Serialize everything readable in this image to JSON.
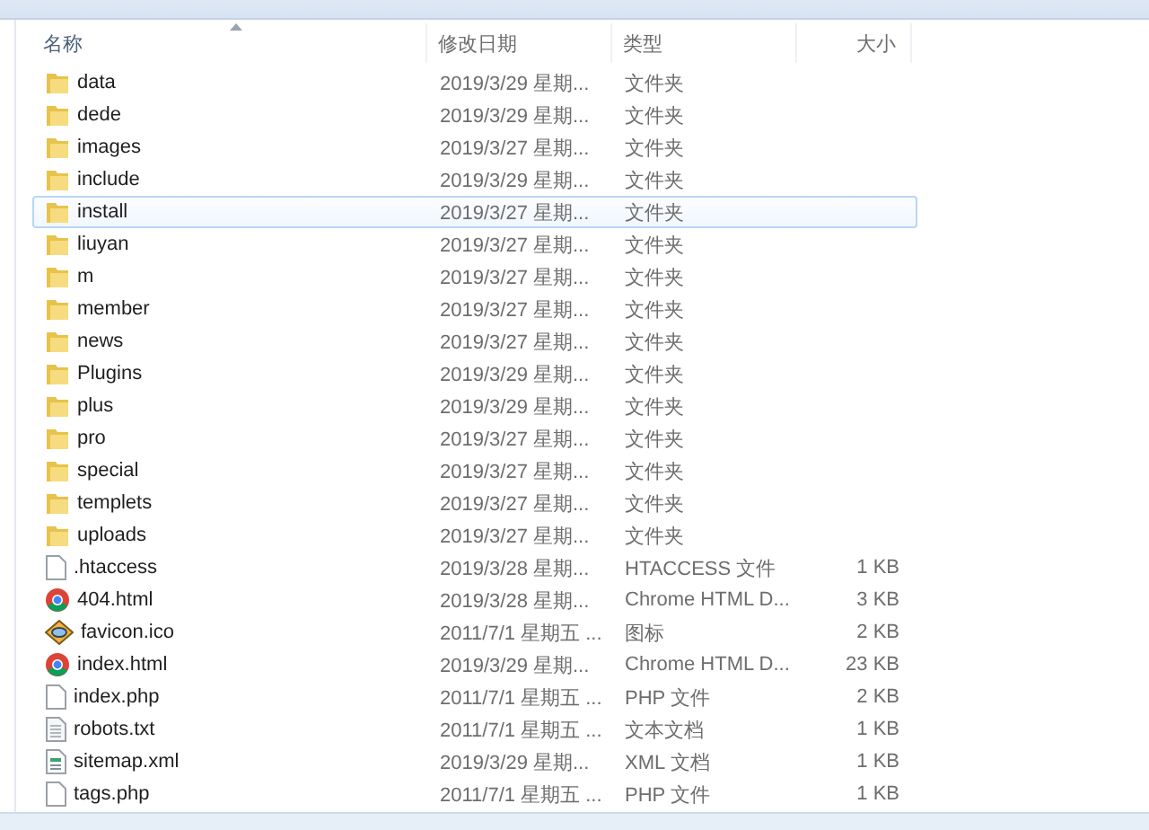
{
  "table": {
    "columns": [
      {
        "label": "名称",
        "sorted": true
      },
      {
        "label": "修改日期",
        "sorted": false
      },
      {
        "label": "类型",
        "sorted": false
      },
      {
        "label": "大小",
        "sorted": false
      }
    ],
    "rows": [
      {
        "kind": "folder",
        "name": "data",
        "date": "2019/3/29 星期...",
        "type": "文件夹",
        "size": "",
        "selected": false
      },
      {
        "kind": "folder",
        "name": "dede",
        "date": "2019/3/29 星期...",
        "type": "文件夹",
        "size": "",
        "selected": false
      },
      {
        "kind": "folder",
        "name": "images",
        "date": "2019/3/27 星期...",
        "type": "文件夹",
        "size": "",
        "selected": false
      },
      {
        "kind": "folder",
        "name": "include",
        "date": "2019/3/29 星期...",
        "type": "文件夹",
        "size": "",
        "selected": false
      },
      {
        "kind": "folder",
        "name": "install",
        "date": "2019/3/27 星期...",
        "type": "文件夹",
        "size": "",
        "selected": true
      },
      {
        "kind": "folder",
        "name": "liuyan",
        "date": "2019/3/27 星期...",
        "type": "文件夹",
        "size": "",
        "selected": false
      },
      {
        "kind": "folder",
        "name": "m",
        "date": "2019/3/27 星期...",
        "type": "文件夹",
        "size": "",
        "selected": false
      },
      {
        "kind": "folder",
        "name": "member",
        "date": "2019/3/27 星期...",
        "type": "文件夹",
        "size": "",
        "selected": false
      },
      {
        "kind": "folder",
        "name": "news",
        "date": "2019/3/27 星期...",
        "type": "文件夹",
        "size": "",
        "selected": false
      },
      {
        "kind": "folder",
        "name": "Plugins",
        "date": "2019/3/29 星期...",
        "type": "文件夹",
        "size": "",
        "selected": false
      },
      {
        "kind": "folder",
        "name": "plus",
        "date": "2019/3/29 星期...",
        "type": "文件夹",
        "size": "",
        "selected": false
      },
      {
        "kind": "folder",
        "name": "pro",
        "date": "2019/3/27 星期...",
        "type": "文件夹",
        "size": "",
        "selected": false
      },
      {
        "kind": "folder",
        "name": "special",
        "date": "2019/3/27 星期...",
        "type": "文件夹",
        "size": "",
        "selected": false
      },
      {
        "kind": "folder",
        "name": "templets",
        "date": "2019/3/27 星期...",
        "type": "文件夹",
        "size": "",
        "selected": false
      },
      {
        "kind": "folder",
        "name": "uploads",
        "date": "2019/3/27 星期...",
        "type": "文件夹",
        "size": "",
        "selected": false
      },
      {
        "kind": "blank",
        "name": ".htaccess",
        "date": "2019/3/28 星期...",
        "type": "HTACCESS 文件",
        "size": "1 KB",
        "selected": false
      },
      {
        "kind": "chrome",
        "name": "404.html",
        "date": "2019/3/28 星期...",
        "type": "Chrome HTML D...",
        "size": "3 KB",
        "selected": false
      },
      {
        "kind": "ico",
        "name": "favicon.ico",
        "date": "2011/7/1 星期五 ...",
        "type": "图标",
        "size": "2 KB",
        "selected": false
      },
      {
        "kind": "chrome",
        "name": "index.html",
        "date": "2019/3/29 星期...",
        "type": "Chrome HTML D...",
        "size": "23 KB",
        "selected": false
      },
      {
        "kind": "blank",
        "name": "index.php",
        "date": "2011/7/1 星期五 ...",
        "type": "PHP 文件",
        "size": "2 KB",
        "selected": false
      },
      {
        "kind": "text",
        "name": "robots.txt",
        "date": "2011/7/1 星期五 ...",
        "type": "文本文档",
        "size": "1 KB",
        "selected": false
      },
      {
        "kind": "xml",
        "name": "sitemap.xml",
        "date": "2019/3/29 星期...",
        "type": "XML 文档",
        "size": "1 KB",
        "selected": false
      },
      {
        "kind": "blank",
        "name": "tags.php",
        "date": "2011/7/1 星期五 ...",
        "type": "PHP 文件",
        "size": "1 KB",
        "selected": false
      }
    ]
  }
}
